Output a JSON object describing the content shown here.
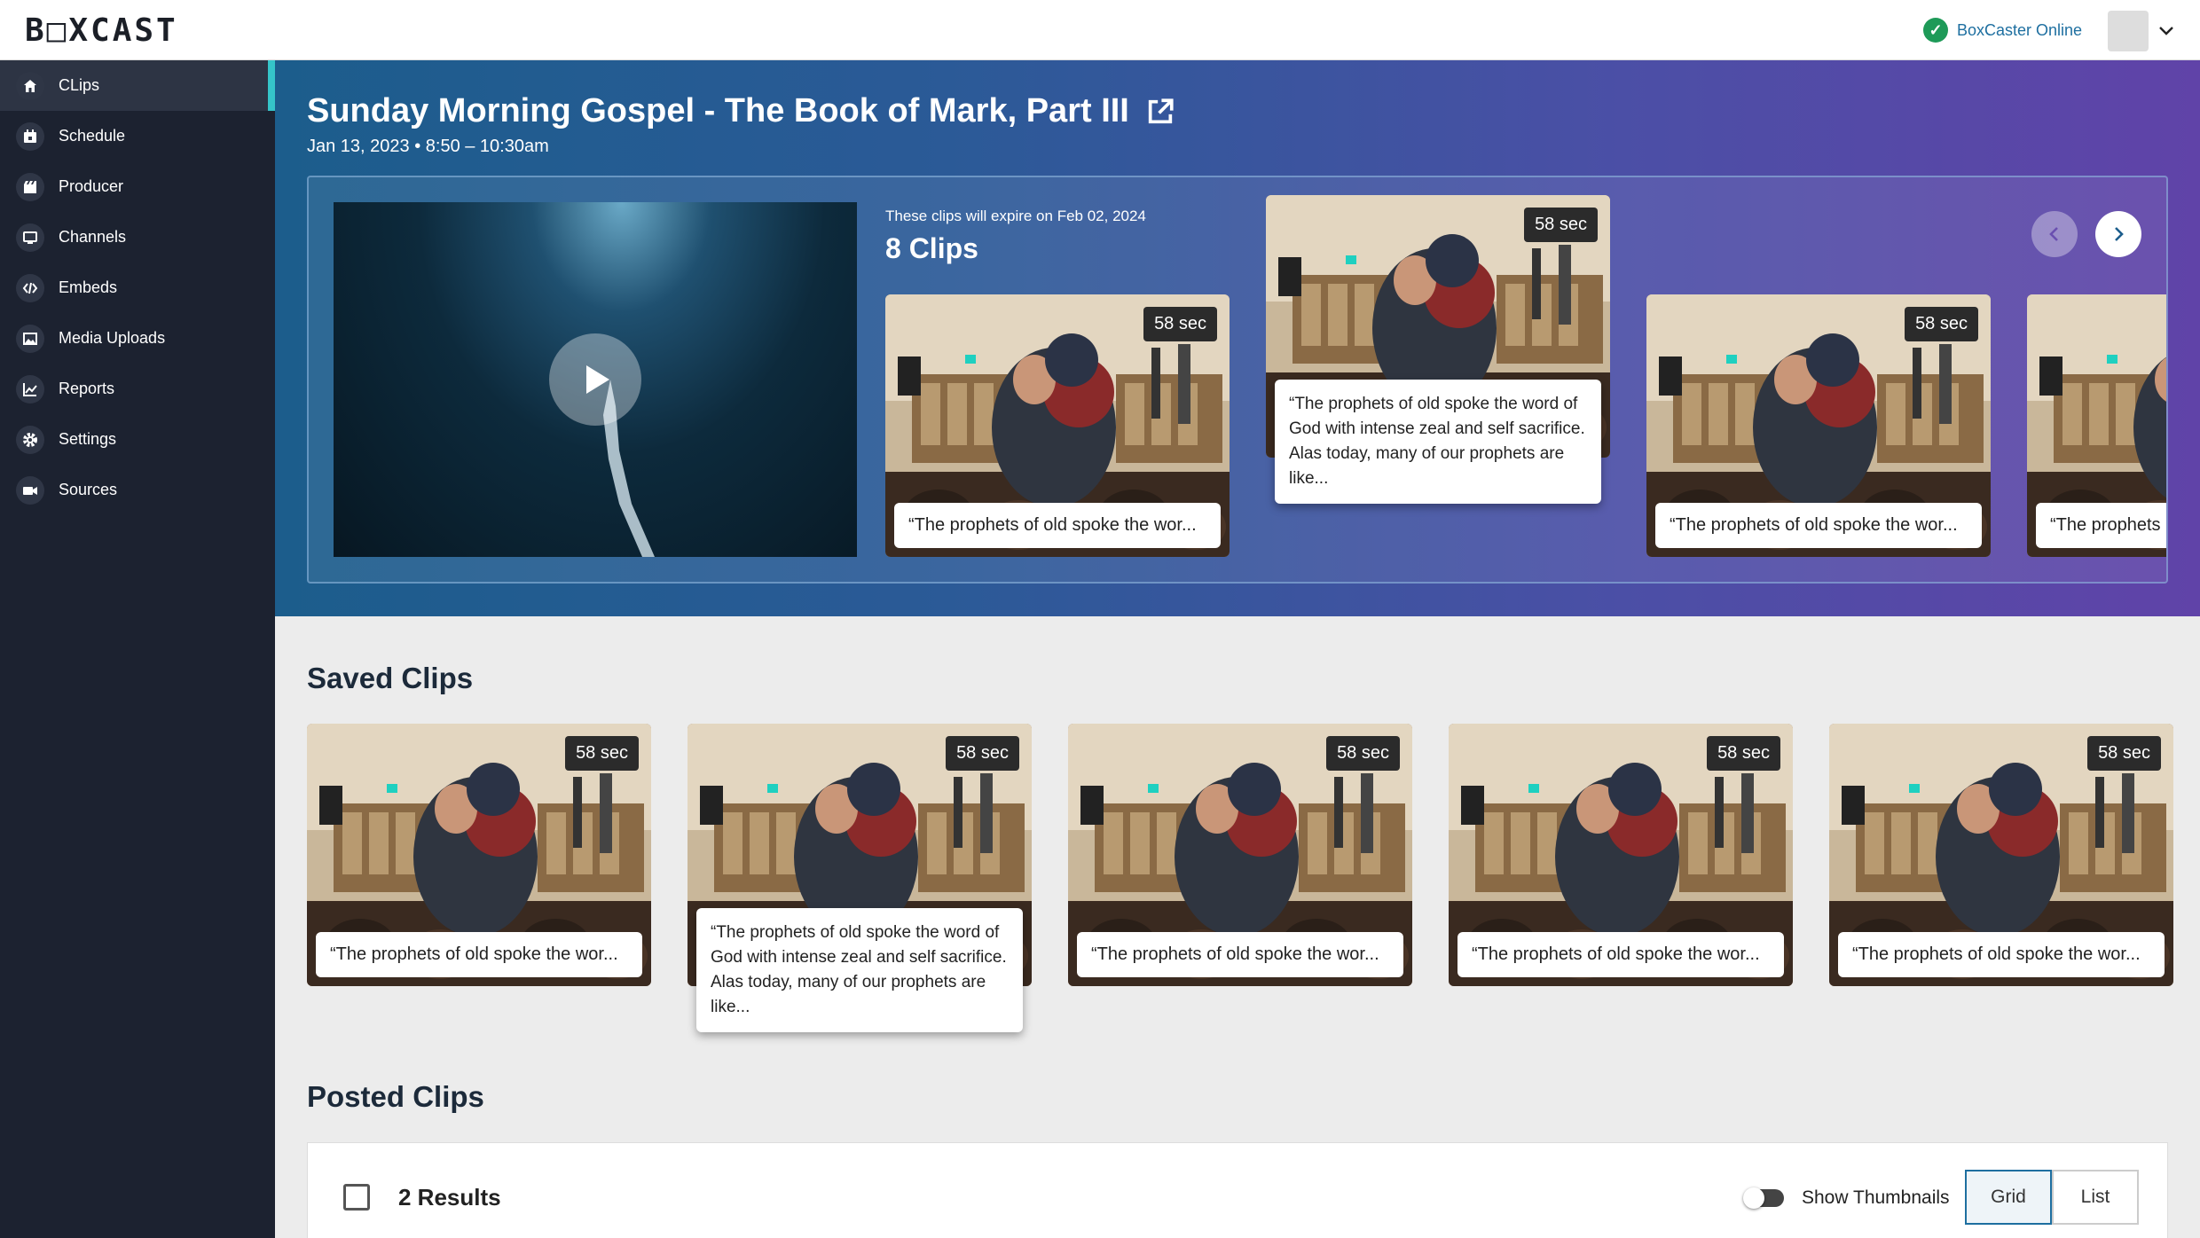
{
  "app": {
    "logo": "B□XCAST"
  },
  "status": {
    "text": "BoxCaster Online",
    "color": "#1e9a58"
  },
  "sidebar": {
    "items": [
      {
        "label": "CLips",
        "icon": "home-icon",
        "active": true
      },
      {
        "label": "Schedule",
        "icon": "calendar-icon"
      },
      {
        "label": "Producer",
        "icon": "producer-icon"
      },
      {
        "label": "Channels",
        "icon": "monitor-icon"
      },
      {
        "label": "Embeds",
        "icon": "code-icon"
      },
      {
        "label": "Media Uploads",
        "icon": "image-icon"
      },
      {
        "label": "Reports",
        "icon": "chart-icon"
      },
      {
        "label": "Settings",
        "icon": "gear-icon"
      },
      {
        "label": "Sources",
        "icon": "camera-icon"
      }
    ]
  },
  "hero": {
    "title": "Sunday Morning Gospel - The Book of Mark, Part III",
    "date": "Jan 13, 2023 • 8:50 – 10:30am",
    "expire": "These clips will expire on Feb 02, 2024",
    "clip_count": "8 Clips",
    "clips": [
      {
        "duration": "58 sec",
        "caption": "“The prophets of old spoke the wor..."
      },
      {
        "duration": "58 sec",
        "caption": "“The prophets of old spoke the word of God with intense zeal and self sacrifice. Alas today, many of our prophets are like..."
      },
      {
        "duration": "58 sec",
        "caption": "“The prophets of old spoke the wor..."
      },
      {
        "duration": "58 sec",
        "caption": "“The prophets"
      }
    ]
  },
  "saved": {
    "title": "Saved Clips",
    "clips": [
      {
        "duration": "58 sec",
        "caption": "“The prophets of old spoke the wor..."
      },
      {
        "duration": "58 sec",
        "caption": "“The prophets of old spoke the word of God with intense zeal and self sacrifice. Alas today, many of our prophets are like..."
      },
      {
        "duration": "58 sec",
        "caption": "“The prophets of old spoke the wor..."
      },
      {
        "duration": "58 sec",
        "caption": "“The prophets of old spoke the wor..."
      },
      {
        "duration": "58 sec",
        "caption": "“The prophets of old spoke the wor..."
      }
    ]
  },
  "posted": {
    "title": "Posted Clips",
    "results": "2 Results",
    "thumbnails_label": "Show Thumbnails",
    "grid_label": "Grid",
    "list_label": "List"
  }
}
